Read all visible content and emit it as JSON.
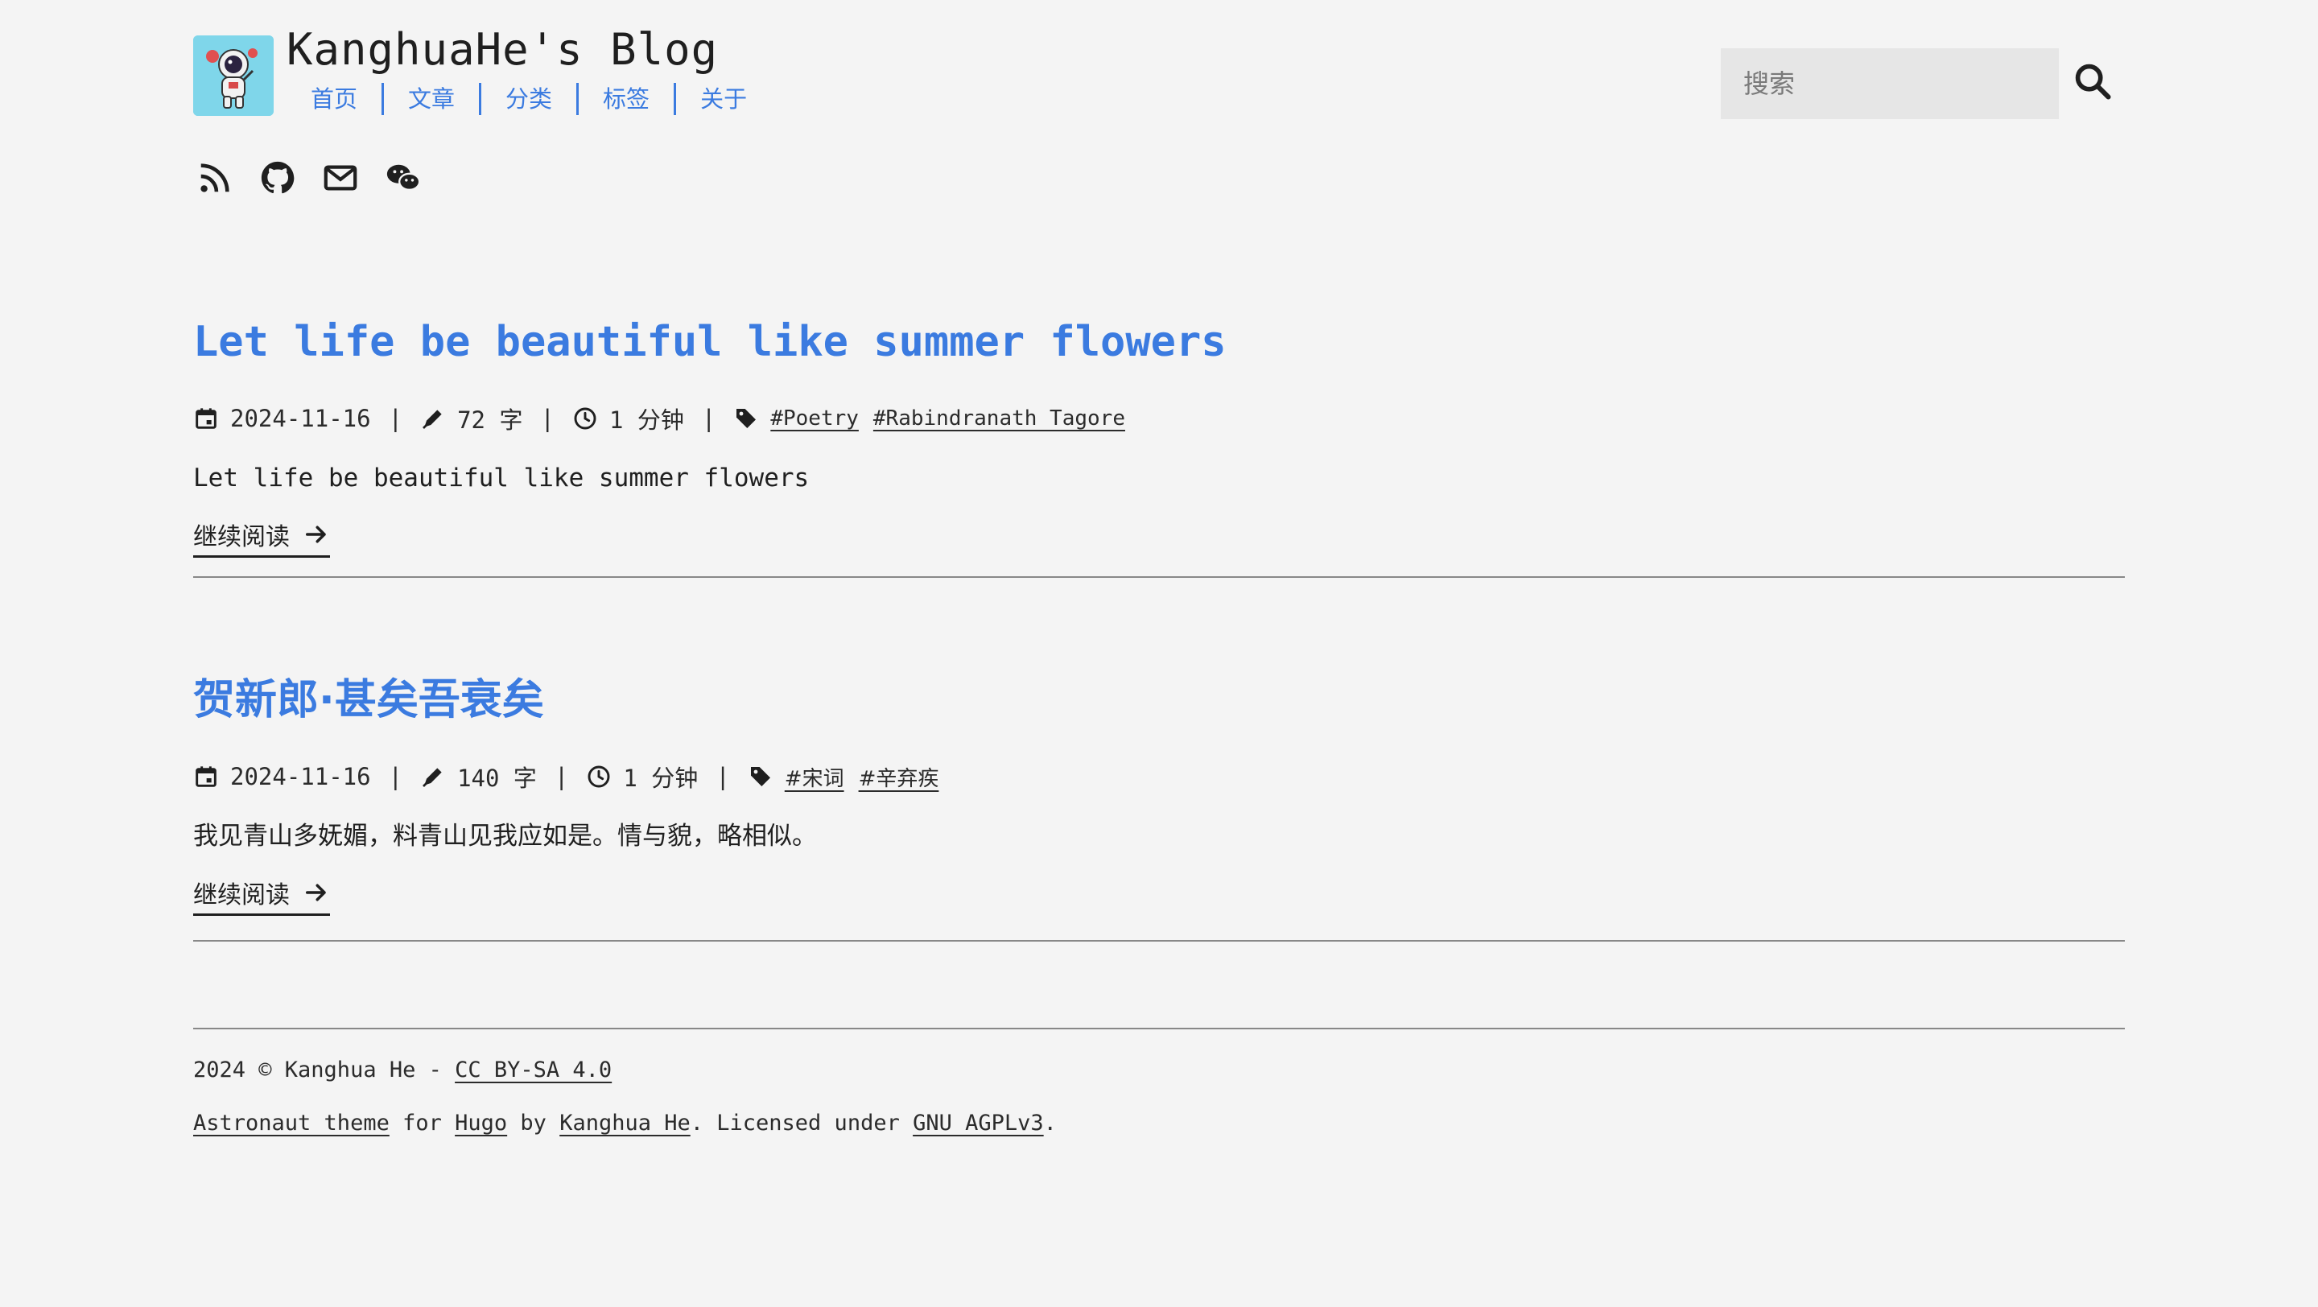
{
  "site": {
    "title": "KanghuaHe's Blog",
    "logo_alt": "astronaut-logo"
  },
  "nav": {
    "items": [
      {
        "label": "首页"
      },
      {
        "label": "文章"
      },
      {
        "label": "分类"
      },
      {
        "label": "标签"
      },
      {
        "label": "关于"
      }
    ]
  },
  "search": {
    "placeholder": "搜索",
    "icon": "search-icon"
  },
  "socials": {
    "items": [
      {
        "icon": "rss-icon"
      },
      {
        "icon": "github-icon"
      },
      {
        "icon": "mail-icon"
      },
      {
        "icon": "wechat-icon"
      }
    ]
  },
  "posts": [
    {
      "title": "Let life be beautiful like summer flowers",
      "date": "2024-11-16",
      "words": "72 字",
      "read_time": "1 分钟",
      "tags": [
        "#Poetry",
        "#Rabindranath Tagore"
      ],
      "summary": "Let life be beautiful like summer flowers",
      "read_more": "继续阅读"
    },
    {
      "title": "贺新郎·甚矣吾衰矣",
      "date": "2024-11-16",
      "words": "140 字",
      "read_time": "1 分钟",
      "tags": [
        "#宋词",
        "#辛弃疾"
      ],
      "summary": "我见青山多妩媚，料青山见我应如是。情与貌，略相似。",
      "read_more": "继续阅读"
    }
  ],
  "footer": {
    "copyright": "2024 © Kanghua He - ",
    "license_link": "CC BY-SA 4.0",
    "theme_link": "Astronaut theme",
    "for_text": " for ",
    "hugo_link": "Hugo",
    "by_text": " by ",
    "author_link": "Kanghua He",
    "licensed_text": ". Licensed under ",
    "agpl_link": "GNU AGPLv3",
    "end_text": "."
  },
  "colors": {
    "accent": "#3b7be0",
    "background": "#f4f4f4",
    "text": "#1f1f1f"
  }
}
